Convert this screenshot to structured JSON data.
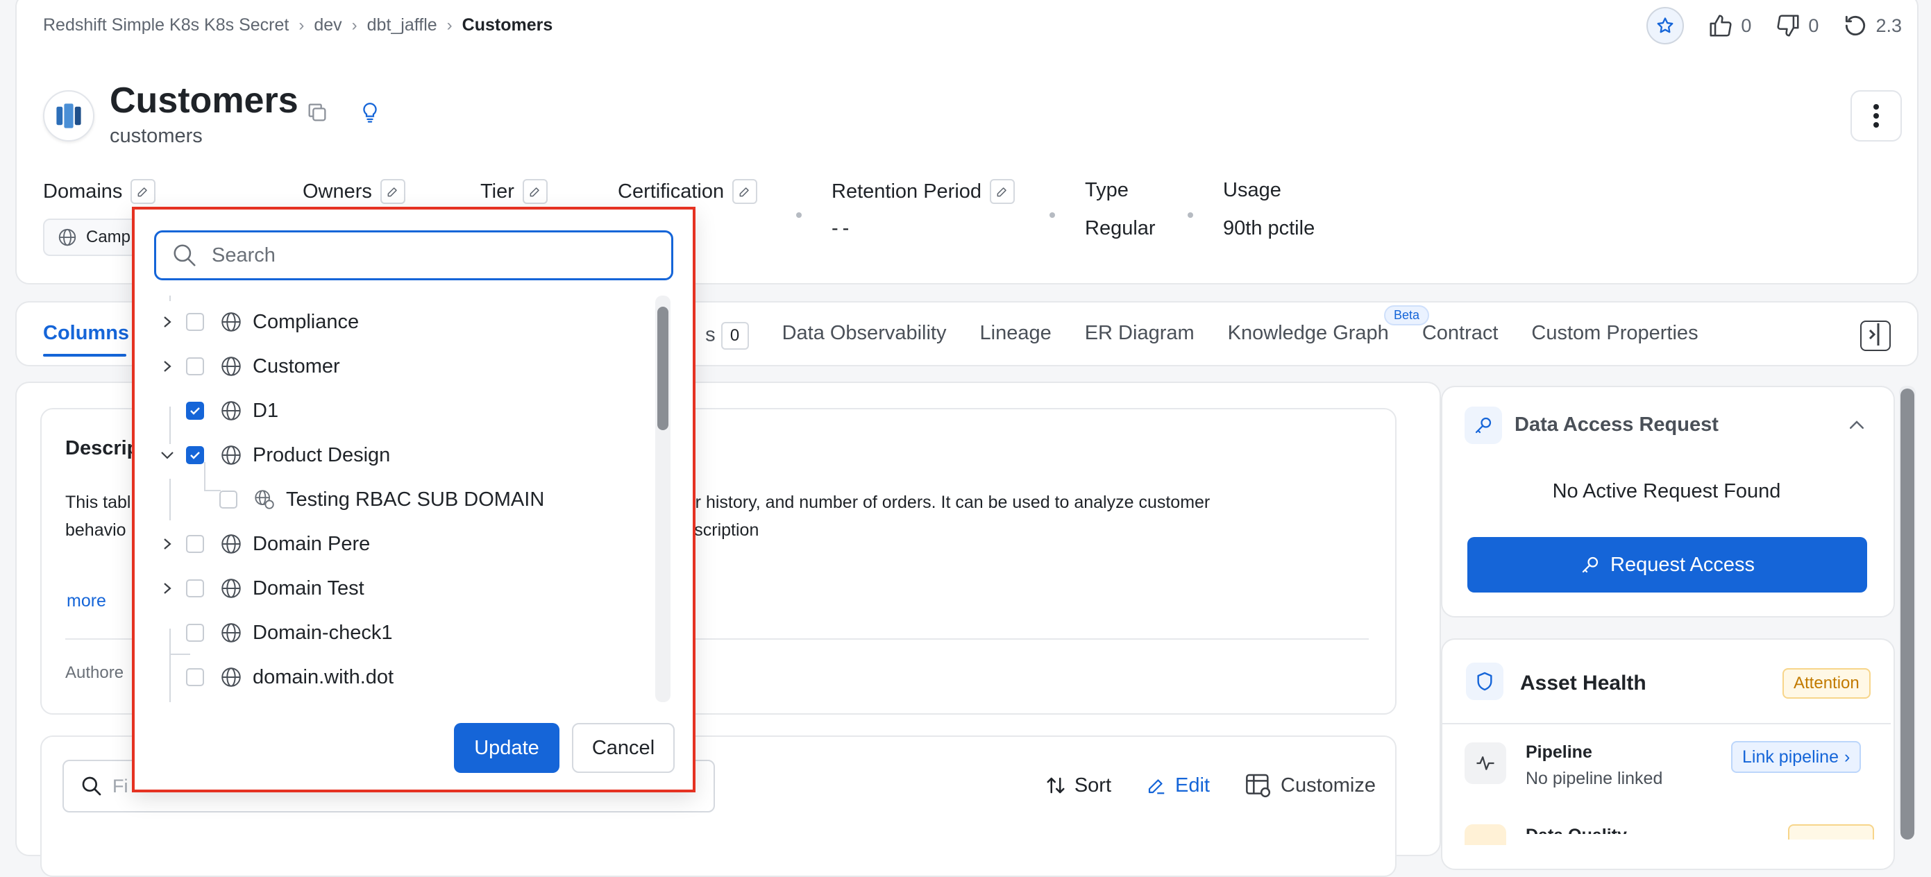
{
  "breadcrumb": {
    "items": [
      "Redshift Simple K8s K8s Secret",
      "dev",
      "dbt_jaffle"
    ],
    "current": "Customers"
  },
  "topright": {
    "likes": "0",
    "dislikes": "0",
    "version": "2.3"
  },
  "entity": {
    "title": "Customers",
    "subtitle": "customers"
  },
  "meta": {
    "domains_label": "Domains",
    "domain_chip": "Camp",
    "owners_label": "Owners",
    "tier_label": "Tier",
    "certification_label": "Certification",
    "retention_label": "Retention Period",
    "retention_value": "--",
    "type_label": "Type",
    "type_value": "Regular",
    "usage_label": "Usage",
    "usage_value": "90th pctile"
  },
  "tabs": {
    "columns": "Columns",
    "hidden_suffix": "s",
    "hidden_count": "0",
    "observability": "Data Observability",
    "lineage": "Lineage",
    "er": "ER Diagram",
    "kg": "Knowledge Graph",
    "beta": "Beta",
    "contract": "Contract",
    "custom": "Custom Properties"
  },
  "description": {
    "title": "Descrip",
    "line1a": "This tabl",
    "line1b": "alue, order history, and number of orders. It can be used to analyze customer",
    "line2a": "behavio",
    "line2b": "better description",
    "more": "more",
    "authored": "Authore"
  },
  "table_tools": {
    "filter_placeholder": "Fi",
    "sort": "Sort",
    "edit": "Edit",
    "customize": "Customize"
  },
  "access": {
    "title": "Data Access Request",
    "empty": "No Active Request Found",
    "button": "Request Access"
  },
  "health": {
    "title": "Asset Health",
    "status": "Attention",
    "pipeline_title": "Pipeline",
    "pipeline_sub": "No pipeline linked",
    "link_pipeline": "Link pipeline",
    "dq_title": "Data Quality"
  },
  "dropdown": {
    "search_placeholder": "Search",
    "items": [
      {
        "label": "Compliance",
        "checked": false,
        "expandable": true
      },
      {
        "label": "Customer",
        "checked": false,
        "expandable": true
      },
      {
        "label": "D1",
        "checked": true,
        "expandable": false
      },
      {
        "label": "Product Design",
        "checked": true,
        "expandable": true,
        "expanded": true
      },
      {
        "label": "Testing RBAC SUB DOMAIN",
        "checked": false,
        "child": true
      },
      {
        "label": "Domain Pere",
        "checked": false,
        "expandable": true
      },
      {
        "label": "Domain Test",
        "checked": false,
        "expandable": true
      },
      {
        "label": "Domain-check1",
        "checked": false,
        "expandable": false
      },
      {
        "label": "domain.with.dot",
        "checked": false,
        "expandable": false
      }
    ],
    "update": "Update",
    "cancel": "Cancel"
  },
  "colors": {
    "accent": "#1565d8",
    "highlight_border": "#e53222",
    "attention": "#c27a00"
  }
}
